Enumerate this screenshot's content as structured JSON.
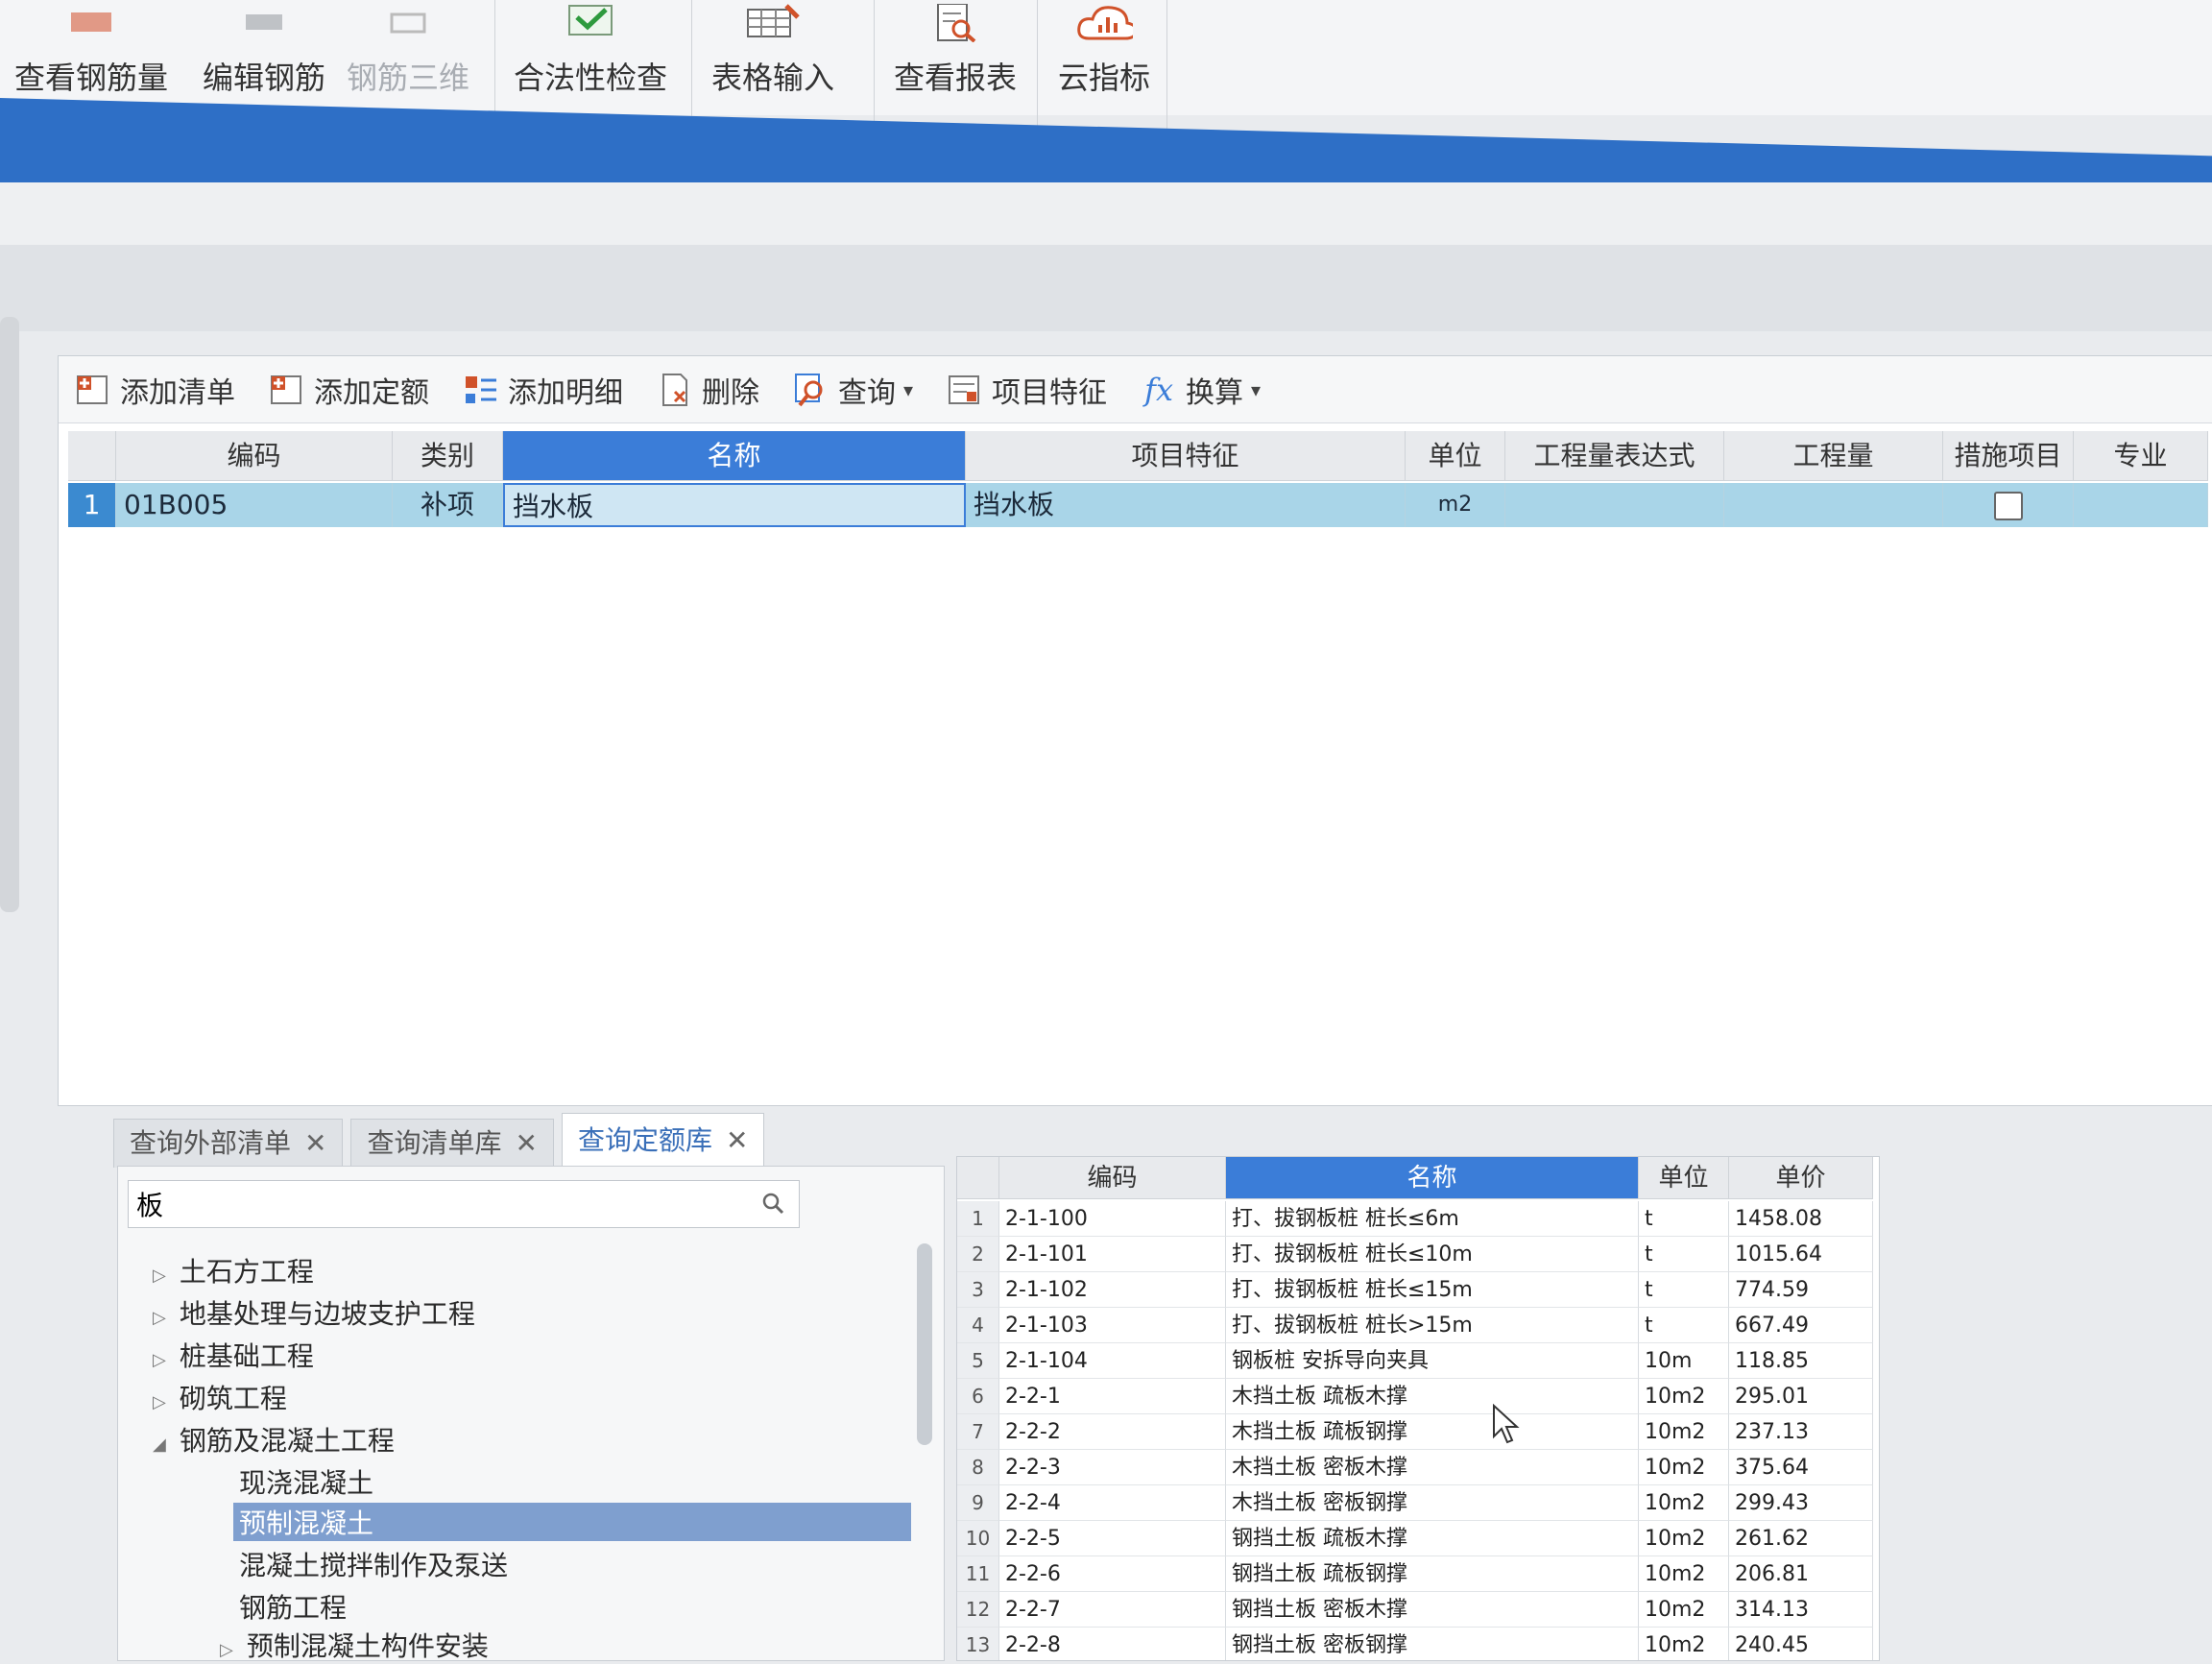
{
  "ribbon": {
    "items": [
      {
        "label": "查看钢筋量",
        "icon": "rebar-amount-icon"
      },
      {
        "label": "编辑钢筋",
        "icon": "edit-rebar-icon"
      },
      {
        "label": "钢筋三维",
        "icon": "rebar-3d-icon"
      },
      {
        "label": "合法性检查",
        "icon": "check-icon"
      },
      {
        "label": "表格输入",
        "icon": "table-input-icon"
      },
      {
        "label": "查看报表",
        "icon": "report-icon"
      },
      {
        "label": "云指标",
        "icon": "cloud-chart-icon"
      }
    ]
  },
  "toolbar": {
    "add_list": "添加清单",
    "add_quota": "添加定额",
    "add_detail": "添加明细",
    "delete": "删除",
    "query": "查询",
    "feature": "项目特征",
    "convert": "换算"
  },
  "grid": {
    "columns": [
      "编码",
      "类别",
      "名称",
      "项目特征",
      "单位",
      "工程量表达式",
      "工程量",
      "措施项目",
      "专业"
    ],
    "rows": [
      {
        "index": "1",
        "code": "01B005",
        "category": "补项",
        "name": "挡水板",
        "feature": "挡水板",
        "unit": "m2",
        "expr": "",
        "qty": "",
        "measure": false,
        "major": ""
      }
    ]
  },
  "tabs": [
    {
      "label": "查询外部清单",
      "active": false
    },
    {
      "label": "查询清单库",
      "active": false
    },
    {
      "label": "查询定额库",
      "active": true
    }
  ],
  "search": {
    "value": "板"
  },
  "tree": [
    {
      "label": "土石方工程",
      "arrow": "▷",
      "level": 0
    },
    {
      "label": "地基处理与边坡支护工程",
      "arrow": "▷",
      "level": 0
    },
    {
      "label": "桩基础工程",
      "arrow": "▷",
      "level": 0
    },
    {
      "label": "砌筑工程",
      "arrow": "▷",
      "level": 0
    },
    {
      "label": "钢筋及混凝土工程",
      "arrow": "◢",
      "level": 0
    },
    {
      "label": "现浇混凝土",
      "arrow": "",
      "level": 1
    },
    {
      "label": "预制混凝土",
      "arrow": "",
      "level": 1,
      "selected": true
    },
    {
      "label": "混凝土搅拌制作及泵送",
      "arrow": "",
      "level": 1
    },
    {
      "label": "钢筋工程",
      "arrow": "",
      "level": 1
    },
    {
      "label": "预制混凝土构件安装",
      "arrow": "▷",
      "level": 1
    }
  ],
  "library": {
    "columns": [
      "编码",
      "名称",
      "单位",
      "单价"
    ],
    "rows": [
      {
        "n": "1",
        "code": "2-1-100",
        "name": "打、拔钢板桩 桩长≤6m",
        "unit": "t",
        "price": "1458.08"
      },
      {
        "n": "2",
        "code": "2-1-101",
        "name": "打、拔钢板桩 桩长≤10m",
        "unit": "t",
        "price": "1015.64"
      },
      {
        "n": "3",
        "code": "2-1-102",
        "name": "打、拔钢板桩 桩长≤15m",
        "unit": "t",
        "price": "774.59"
      },
      {
        "n": "4",
        "code": "2-1-103",
        "name": "打、拔钢板桩 桩长>15m",
        "unit": "t",
        "price": "667.49"
      },
      {
        "n": "5",
        "code": "2-1-104",
        "name": "钢板桩 安拆导向夹具",
        "unit": "10m",
        "price": "118.85"
      },
      {
        "n": "6",
        "code": "2-2-1",
        "name": "木挡土板 疏板木撑",
        "unit": "10m2",
        "price": "295.01"
      },
      {
        "n": "7",
        "code": "2-2-2",
        "name": "木挡土板 疏板钢撑",
        "unit": "10m2",
        "price": "237.13"
      },
      {
        "n": "8",
        "code": "2-2-3",
        "name": "木挡土板 密板木撑",
        "unit": "10m2",
        "price": "375.64"
      },
      {
        "n": "9",
        "code": "2-2-4",
        "name": "木挡土板 密板钢撑",
        "unit": "10m2",
        "price": "299.43"
      },
      {
        "n": "10",
        "code": "2-2-5",
        "name": "钢挡土板 疏板木撑",
        "unit": "10m2",
        "price": "261.62"
      },
      {
        "n": "11",
        "code": "2-2-6",
        "name": "钢挡土板 疏板钢撑",
        "unit": "10m2",
        "price": "206.81"
      },
      {
        "n": "12",
        "code": "2-2-7",
        "name": "钢挡土板 密板木撑",
        "unit": "10m2",
        "price": "314.13"
      },
      {
        "n": "13",
        "code": "2-2-8",
        "name": "钢挡土板 密板钢撑",
        "unit": "10m2",
        "price": "240.45"
      }
    ]
  },
  "colors": {
    "accent": "#3b7dd8",
    "band": "#2e6fc6",
    "row_highlight": "#a9d5e8"
  }
}
